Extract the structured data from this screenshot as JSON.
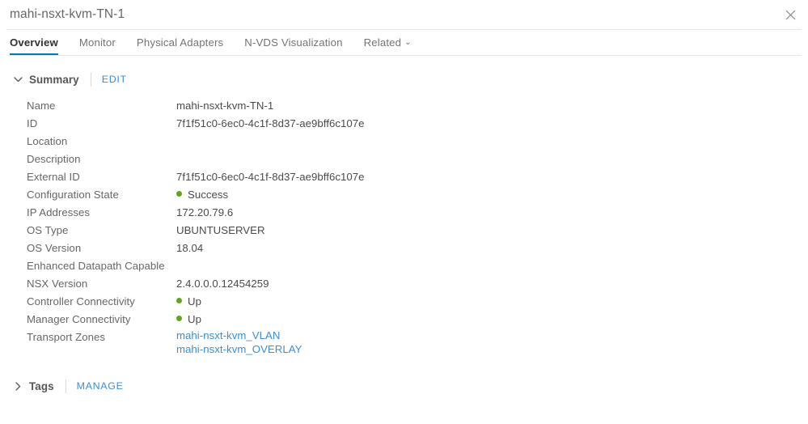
{
  "window": {
    "title": "mahi-nsxt-kvm-TN-1",
    "close_icon": "close-icon"
  },
  "tabs": [
    {
      "label": "Overview",
      "active": true
    },
    {
      "label": "Monitor",
      "active": false
    },
    {
      "label": "Physical Adapters",
      "active": false
    },
    {
      "label": "N-VDS Visualization",
      "active": false
    },
    {
      "label": "Related",
      "active": false,
      "caret": "⌄"
    }
  ],
  "summary": {
    "title": "Summary",
    "edit_label": "EDIT",
    "chevron": "chevron-down-icon",
    "rows": [
      {
        "label": "Name",
        "value": "mahi-nsxt-kvm-TN-1"
      },
      {
        "label": "ID",
        "value": "7f1f51c0-6ec0-4c1f-8d37-ae9bff6c107e"
      },
      {
        "label": "Location",
        "value": ""
      },
      {
        "label": "Description",
        "value": ""
      },
      {
        "label": "External ID",
        "value": "7f1f51c0-6ec0-4c1f-8d37-ae9bff6c107e"
      },
      {
        "label": "Configuration State",
        "value": "Success",
        "status": true
      },
      {
        "label": "IP Addresses",
        "value": "172.20.79.6"
      },
      {
        "label": "OS Type",
        "value": "UBUNTUSERVER"
      },
      {
        "label": "OS Version",
        "value": "18.04"
      },
      {
        "label": "Enhanced Datapath Capable",
        "value": ""
      },
      {
        "label": "NSX Version",
        "value": "2.4.0.0.0.12454259"
      },
      {
        "label": "Controller Connectivity",
        "value": "Up",
        "status": true
      },
      {
        "label": "Manager Connectivity",
        "value": "Up",
        "status": true
      },
      {
        "label": "Transport Zones",
        "links": [
          "mahi-nsxt-kvm_VLAN",
          "mahi-nsxt-kvm_OVERLAY"
        ]
      }
    ]
  },
  "tags": {
    "title": "Tags",
    "manage_label": "MANAGE",
    "chevron": "chevron-right-icon"
  },
  "colors": {
    "accent": "#0079b8",
    "link": "#3b8fd4",
    "status_green": "#62a420",
    "text": "#565656"
  }
}
